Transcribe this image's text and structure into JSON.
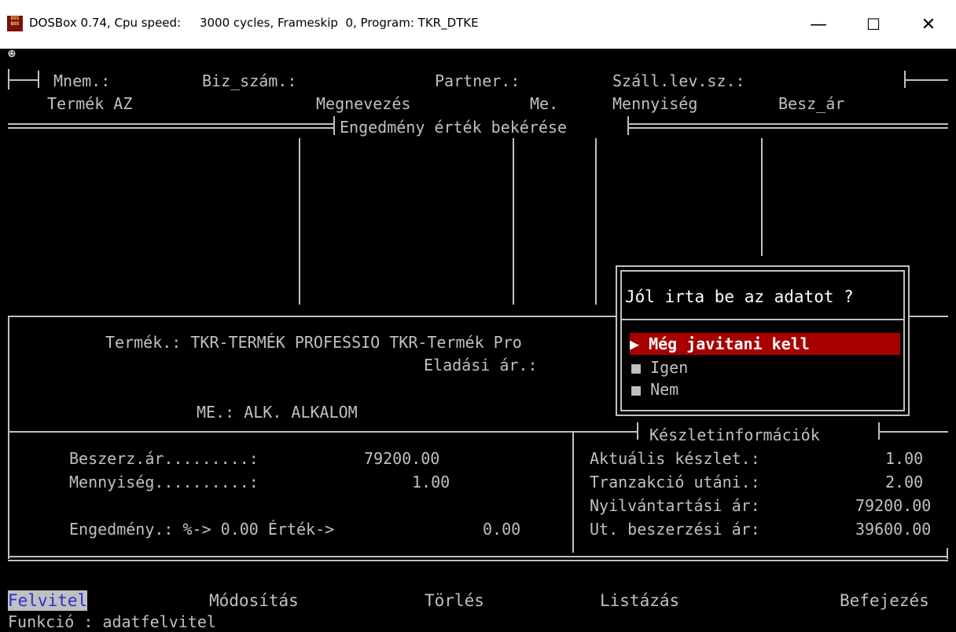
{
  "window": {
    "title": "DOSBox 0.74, Cpu speed:     3000 cycles, Frameskip  0, Program: TKR_DTKE",
    "icon": "dosbox-icon",
    "icon_text": "DOS BOX",
    "controls": {
      "minimize": "—",
      "maximize": "☐",
      "close": "✕"
    }
  },
  "header": {
    "mnem": "Mnem.:",
    "biz_szam": "Biz_szám.:",
    "partner": "Partner.:",
    "szall": "Száll.lev.sz.:",
    "col_termek_az": "Termék AZ",
    "col_megnevezes": "Megnevezés",
    "col_me": "Me.",
    "col_mennyiseg": "Mennyiség",
    "col_besz_ar": "Besz_ár",
    "section_title": "Engedmény érték bekérése"
  },
  "product": {
    "termek_line": "Termék.: TKR-TERMÉK PROFESSIO TKR-Termék Pro",
    "eladasi_ar_label": "Eladási ár.:",
    "me_line": "ME.: ALK. ALKALOM"
  },
  "left_panel": {
    "beszerz_label": "Beszerz.ár.........:",
    "beszerz_value": "79200.00",
    "mennyiseg_label": "Mennyiség..........:",
    "mennyiseg_value": "1.00",
    "engedmeny_line": "Engedmény.: %-> 0.00 Érték->",
    "ertek_value": "0.00"
  },
  "stock_panel": {
    "title": "Készletinformációk",
    "rows": [
      {
        "label": "Aktuális készlet.:",
        "value": "1.00"
      },
      {
        "label": "Tranzakció utáni.:",
        "value": "2.00"
      },
      {
        "label": "Nyilvántartási ár:",
        "value": "79200.00"
      },
      {
        "label": "Ut. beszerzési ár:",
        "value": "39600.00"
      }
    ]
  },
  "dialog": {
    "question": "Jól irta be az adatot ?",
    "options": [
      {
        "label": "▶ Még javitani kell",
        "selected": true
      },
      {
        "label": "■ Igen",
        "selected": false
      },
      {
        "label": "■ Nem",
        "selected": false
      }
    ]
  },
  "menu": {
    "items": [
      "Felvitel",
      "Módosítás",
      "Törlés",
      "Listázás",
      "Befejezés"
    ],
    "active_index": 0
  },
  "status": "Funkció : adatfelvitel",
  "colors": {
    "text": "#c0c0c0",
    "highlight": "#a80000",
    "menu_active_fg": "#2b2bd6",
    "menu_active_bg": "#c0c0c0",
    "background": "#000000"
  }
}
